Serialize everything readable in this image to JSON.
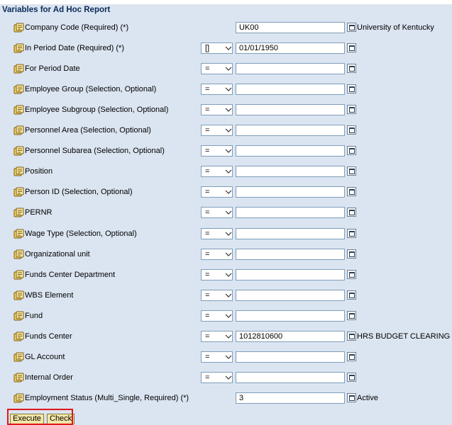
{
  "header": {
    "title": "Variables for Ad Hoc Report"
  },
  "rows": [
    {
      "label": "Company Code (Required) (*)",
      "operator": null,
      "value": "UK00",
      "description": "University of Kentucky"
    },
    {
      "label": "In Period Date (Required) (*)",
      "operator": "[]",
      "value": "01/01/1950",
      "description": ""
    },
    {
      "label": "For Period Date",
      "operator": "=",
      "value": "",
      "description": ""
    },
    {
      "label": "Employee Group (Selection, Optional)",
      "operator": "=",
      "value": "",
      "description": ""
    },
    {
      "label": "Employee Subgroup (Selection, Optional)",
      "operator": "=",
      "value": "",
      "description": ""
    },
    {
      "label": "Personnel Area (Selection, Optional)",
      "operator": "=",
      "value": "",
      "description": ""
    },
    {
      "label": "Personnel Subarea (Selection, Optional)",
      "operator": "=",
      "value": "",
      "description": ""
    },
    {
      "label": "Position",
      "operator": "=",
      "value": "",
      "description": ""
    },
    {
      "label": "Person ID (Selection, Optional)",
      "operator": "=",
      "value": "",
      "description": ""
    },
    {
      "label": "PERNR",
      "operator": "=",
      "value": "",
      "description": ""
    },
    {
      "label": "Wage Type (Selection, Optional)",
      "operator": "=",
      "value": "",
      "description": ""
    },
    {
      "label": "Organizational unit",
      "operator": "=",
      "value": "",
      "description": ""
    },
    {
      "label": "Funds Center Department",
      "operator": "=",
      "value": "",
      "description": ""
    },
    {
      "label": "WBS Element",
      "operator": "=",
      "value": "",
      "description": ""
    },
    {
      "label": "Fund",
      "operator": "=",
      "value": "",
      "description": ""
    },
    {
      "label": "Funds Center",
      "operator": "=",
      "value": "1012810600",
      "description": "HRS BUDGET CLEARING"
    },
    {
      "label": "GL Account",
      "operator": "=",
      "value": "",
      "description": ""
    },
    {
      "label": "Internal Order",
      "operator": "=",
      "value": "",
      "description": ""
    },
    {
      "label": "Employment Status (Multi_Single, Required) (*)",
      "operator": null,
      "value": "3",
      "description": "Active"
    }
  ],
  "buttons": {
    "execute": "Execute",
    "check": "Check"
  },
  "icons": {
    "variable": "variable-icon",
    "value_help": "value-help-icon",
    "dropdown": "chevron-down-icon"
  },
  "colors": {
    "panel_bg": "#dbe5f1",
    "header_text": "#0b2b57",
    "button_bg": "#f2e7a6",
    "highlight_border": "#e0171d"
  }
}
